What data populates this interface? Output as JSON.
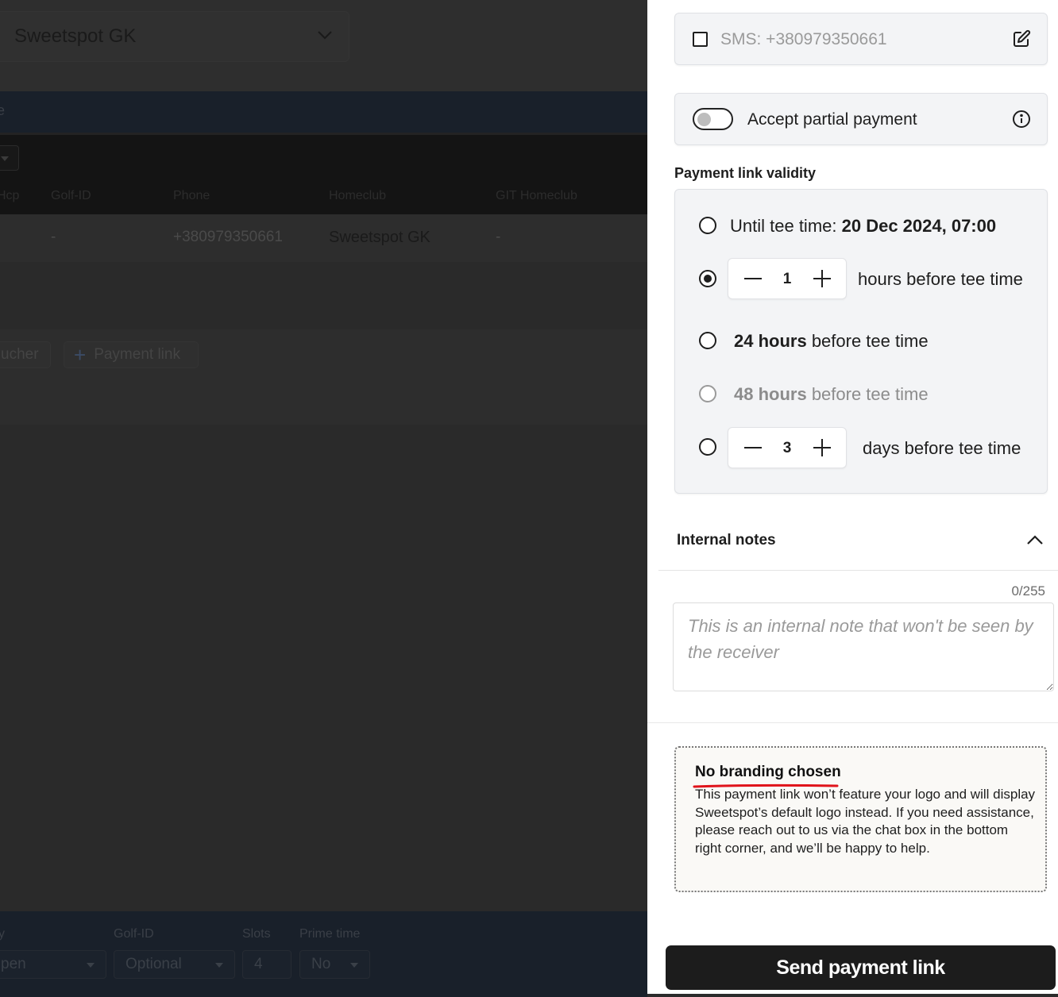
{
  "background": {
    "club_select": "Sweetspot GK",
    "top_bar_fragment": "e",
    "table": {
      "headers": [
        "Hcp",
        "Golf-ID",
        "Phone",
        "Homeclub",
        "GIT Homeclub"
      ],
      "row": [
        "-",
        "+380979350661",
        "Sweetspot GK",
        "-"
      ]
    },
    "buttons": {
      "voucher": "ucher",
      "payment_link": "Payment link"
    },
    "footer": {
      "labels": {
        "y": "y",
        "golf_id": "Golf-ID",
        "slots": "Slots",
        "prime_time": "Prime time"
      },
      "values": {
        "open": "pen",
        "golf_id": "Optional",
        "slots": "4",
        "prime_time": "No"
      }
    }
  },
  "drawer": {
    "sms": {
      "label": "SMS: +380979350661",
      "checked": false
    },
    "partial_payment": {
      "label": "Accept partial payment",
      "enabled": false
    },
    "validity": {
      "title": "Payment link validity",
      "options": [
        {
          "prefix": "Until tee time: ",
          "bold": "20 Dec 2024, 07:00",
          "suffix": "",
          "selected": false,
          "disabled": false
        },
        {
          "stepper": "1",
          "suffix": "hours before tee time",
          "selected": true,
          "disabled": false
        },
        {
          "prefix": "",
          "bold": "24 hours",
          "suffix": " before tee time",
          "selected": false,
          "disabled": false
        },
        {
          "prefix": "",
          "bold": "48 hours",
          "suffix": " before tee time",
          "selected": false,
          "disabled": true
        },
        {
          "stepper": "3",
          "suffix": "days before tee time",
          "selected": false,
          "disabled": false
        }
      ]
    },
    "notes": {
      "title": "Internal notes",
      "counter": "0/255",
      "value": "",
      "placeholder": "This is an internal note that won't be seen by the receiver"
    },
    "branding": {
      "title": "No branding chosen",
      "body": "This payment link won’t feature your logo and will display Sweetspot’s default logo instead. If you need assistance, please reach out to us via the chat box in the bottom right corner, and we’ll be happy to help.",
      "underline_color": "#e0131a"
    },
    "send_button": "Send payment link"
  },
  "colors": {
    "overlay_bg": "#2a2a2a",
    "panel_bg": "#ffffff",
    "card_bg": "#f3f4f6",
    "primary_button": "#1c1c1c",
    "accent_red": "#e0131a"
  }
}
